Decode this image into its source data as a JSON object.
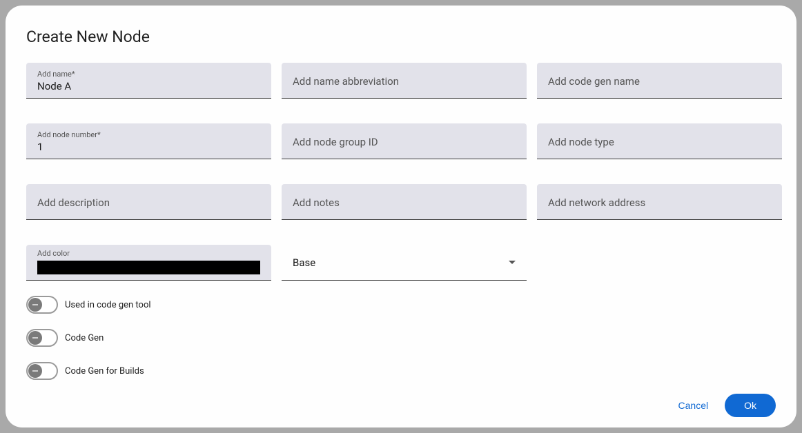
{
  "dialog": {
    "title": "Create New Node"
  },
  "fields": {
    "name": {
      "label": "Add name*",
      "value": "Node A"
    },
    "abbrev": {
      "placeholder": "Add name abbreviation"
    },
    "codegenName": {
      "placeholder": "Add code gen name"
    },
    "nodeNumber": {
      "label": "Add node number*",
      "value": "1"
    },
    "groupId": {
      "placeholder": "Add node group ID"
    },
    "nodeType": {
      "placeholder": "Add node type"
    },
    "description": {
      "placeholder": "Add description"
    },
    "notes": {
      "placeholder": "Add notes"
    },
    "networkAddress": {
      "placeholder": "Add network address"
    },
    "color": {
      "label": "Add color",
      "value": "#000000"
    },
    "baseSelect": {
      "value": "Base"
    }
  },
  "toggles": {
    "usedInTool": {
      "label": "Used in code gen tool",
      "on": false
    },
    "codeGen": {
      "label": "Code Gen",
      "on": false
    },
    "codeGenBuilds": {
      "label": "Code Gen for Builds",
      "on": false
    }
  },
  "actions": {
    "cancel": "Cancel",
    "ok": "Ok"
  }
}
